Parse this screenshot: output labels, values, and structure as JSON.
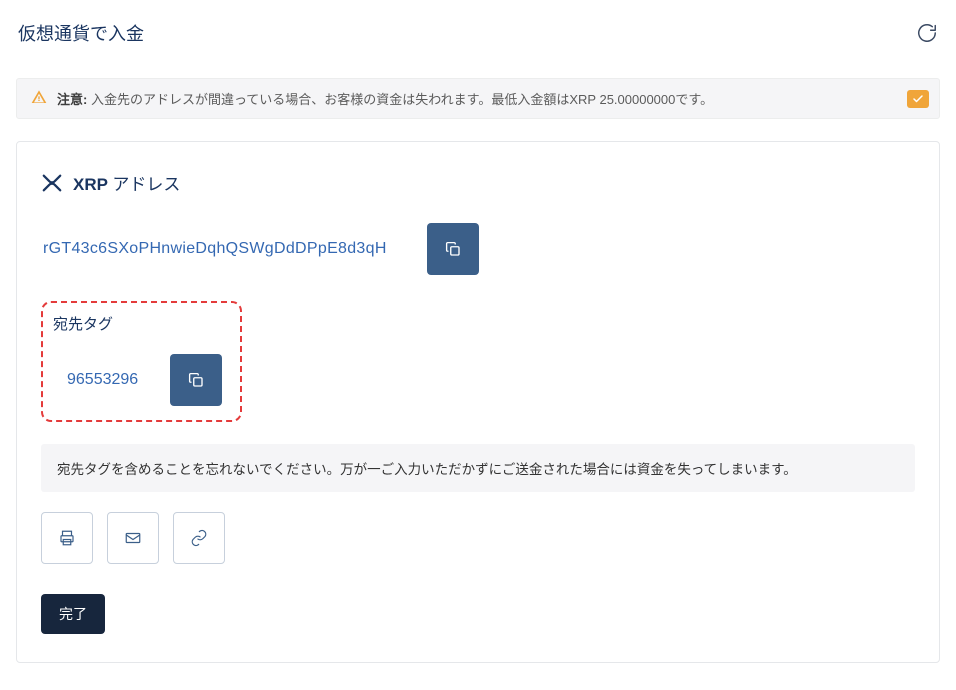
{
  "page": {
    "title": "仮想通貨で入金"
  },
  "alert": {
    "label": "注意:",
    "text": " 入金先のアドレスが間違っている場合、お客様の資金は失われます。最低入金額はXRP 25.00000000です。"
  },
  "address_section": {
    "currency": "XRP",
    "label": "アドレス",
    "address": "rGT43c6SXoPHnwieDqhQSWgDdDPpE8d3qH"
  },
  "tag_section": {
    "label": "宛先タグ",
    "value": "96553296"
  },
  "warning": {
    "text": "宛先タグを含めることを忘れないでください。万が一ご入力いただかずにご送金された場合には資金を失ってしまいます。"
  },
  "buttons": {
    "done": "完了"
  },
  "icons": {
    "refresh": "refresh-icon",
    "warning": "warning-triangle-icon",
    "check": "check-icon",
    "xrp": "xrp-icon",
    "copy": "copy-icon",
    "print": "print-icon",
    "email": "email-icon",
    "link": "link-icon"
  }
}
